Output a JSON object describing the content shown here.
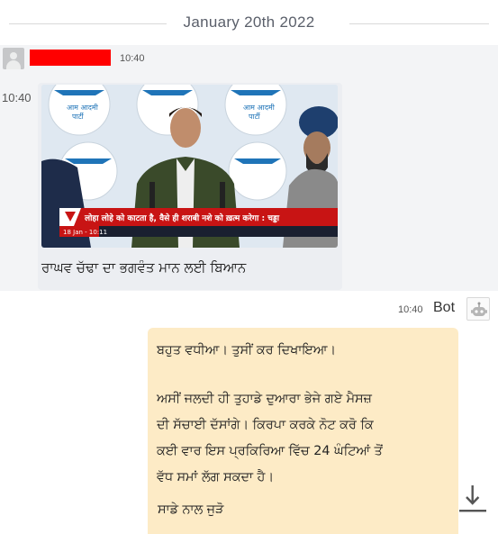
{
  "date_divider": "January 20th 2022",
  "incoming": {
    "header_time": "10:40",
    "side_time": "10:40",
    "image": {
      "headline_hindi": "लोहा लोहे को काटता है, वैसे ही शराबी नशे को ख़त्म करेगा : चड्डा",
      "ticker": "18 Jan - 10:11",
      "banner_logo_text": "आम आदमी पार्टी"
    },
    "caption": "ਰਾਘਵ ਚੱਢਾ ਦਾ ਭਗਵੰਤ ਮਾਨ ਲਈ ਬਿਆਨ"
  },
  "outgoing": {
    "time": "10:40",
    "sender": "Bot",
    "lines": [
      "ਬਹੁਤ ਵਧੀਆ। ਤੁਸੀਂ ਕਰ ਦਿਖਾਇਆ।",
      "",
      "ਅਸੀਂ ਜਲਦੀ ਹੀ ਤੁਹਾਡੇ ਦੁਆਰਾ ਭੇਜੇ ਗਏ ਮੈਸਜ਼",
      "ਦੀ ਸੱਚਾਈ ਦੱਸਾਂਗੇ। ਕਿਰਪਾ ਕਰਕੇ ਨੋਟ ਕਰੋ ਕਿ",
      "ਕਈ ਵਾਰ ਇਸ ਪ੍ਰਕਿਰਿਆ ਵਿੱਚ 24 ਘੰਟਿਆਂ ਤੋਂ",
      "ਵੱਧ ਸਮਾਂ ਲੱਗ ਸਕਦਾ ਹੈ।"
    ],
    "footer": "ਸਾਡੇ ਨਾਲ ਜੁੜੋ"
  },
  "icons": {
    "avatar": "user-placeholder-icon",
    "bot": "bot-icon",
    "download": "download-icon"
  },
  "colors": {
    "outgoing_bubble": "#fdebc6",
    "incoming_bg": "#f3f4f6",
    "redaction": "#ff0000",
    "news_red": "#d01818"
  }
}
